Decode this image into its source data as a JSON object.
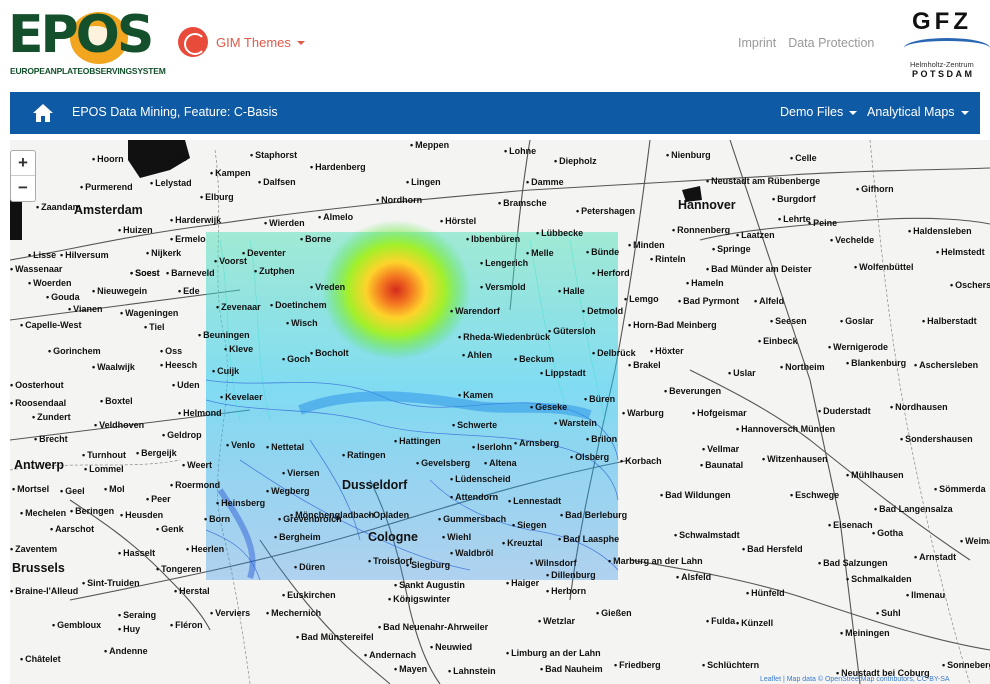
{
  "header": {
    "logo_text": "EPOS",
    "logo_subtitle": "EUROPEANPLATEOBSERVINGSYSTEM",
    "gim_menu_label": "GIM Themes",
    "links": [
      "Imprint",
      "Data Protection"
    ],
    "gfz_text": "GFZ",
    "gfz_subtitle": "Helmholtz-Zentrum",
    "gfz_city": "POTSDAM"
  },
  "navbar": {
    "home_icon": "home-icon",
    "title": "EPOS Data Mining, Feature: C-Basis",
    "menus": [
      "Demo Files",
      "Analytical Maps"
    ]
  },
  "map": {
    "zoom_in": "+",
    "zoom_out": "−",
    "heatmap_colors": [
      "#d11a0a",
      "#f46d10",
      "#ffd11a",
      "#9cf01a",
      "#35e23a",
      "#2adcc8",
      "#23c7f2",
      "#1e8de8",
      "#2156d6"
    ],
    "cities": [
      {
        "name": "Amsterdam",
        "big": true
      },
      {
        "name": "Hannover",
        "big": true
      },
      {
        "name": "Antwerp",
        "big": true
      },
      {
        "name": "Dusseldorf",
        "big": true
      },
      {
        "name": "Cologne",
        "big": true
      },
      {
        "name": "Brussels",
        "big": true
      },
      {
        "name": "Hoorn"
      },
      {
        "name": "Urk"
      },
      {
        "name": "Purmerend"
      },
      {
        "name": "Lelystad"
      },
      {
        "name": "Staphorst"
      },
      {
        "name": "Kampen"
      },
      {
        "name": "Dalfsen"
      },
      {
        "name": "Hardenberg"
      },
      {
        "name": "Meppen"
      },
      {
        "name": "Lohne"
      },
      {
        "name": "Diepholz"
      },
      {
        "name": "Nienburg"
      },
      {
        "name": "Celle"
      },
      {
        "name": "Lingen"
      },
      {
        "name": "Damme"
      },
      {
        "name": "Neustadt am Rübenberge"
      },
      {
        "name": "Gifhorn"
      },
      {
        "name": "Nordhorn"
      },
      {
        "name": "Bramsche"
      },
      {
        "name": "Burgdorf"
      },
      {
        "name": "Zaandam"
      },
      {
        "name": "Harderwijk"
      },
      {
        "name": "Elburg"
      },
      {
        "name": "Almelo"
      },
      {
        "name": "Wierden"
      },
      {
        "name": "Hörstel"
      },
      {
        "name": "Petershagen"
      },
      {
        "name": "Lehrte"
      },
      {
        "name": "Peine"
      },
      {
        "name": "Huizen"
      },
      {
        "name": "Ermelo"
      },
      {
        "name": "Lübbecke"
      },
      {
        "name": "Ronnenberg"
      },
      {
        "name": "Laatzen"
      },
      {
        "name": "Vechelde"
      },
      {
        "name": "Haldensleben"
      },
      {
        "name": "Hilversum"
      },
      {
        "name": "Nijkerk"
      },
      {
        "name": "Minden"
      },
      {
        "name": "Springe"
      },
      {
        "name": "Lisse"
      },
      {
        "name": "Rinteln"
      },
      {
        "name": "Helmstedt"
      },
      {
        "name": "Bünde"
      },
      {
        "name": "Wassenaar"
      },
      {
        "name": "Soest"
      },
      {
        "name": "Barneveld"
      },
      {
        "name": "Herford"
      },
      {
        "name": "Bad Münder am Deister"
      },
      {
        "name": "Wolfenbüttel"
      },
      {
        "name": "Woerden"
      },
      {
        "name": "Hameln"
      },
      {
        "name": "Gouda"
      },
      {
        "name": "Nieuwegein"
      },
      {
        "name": "Ede"
      },
      {
        "name": "Lemgo"
      },
      {
        "name": "Bad Pyrmont"
      },
      {
        "name": "Alfeld"
      },
      {
        "name": "Oschersleben"
      },
      {
        "name": "Vianen"
      },
      {
        "name": "Wageningen"
      },
      {
        "name": "Detmold"
      },
      {
        "name": "Seesen"
      },
      {
        "name": "Goslar"
      },
      {
        "name": "Halberstadt"
      },
      {
        "name": "Capelle-West"
      },
      {
        "name": "Tiel"
      },
      {
        "name": "Horn-Bad Meinberg"
      },
      {
        "name": "Gorinchem"
      },
      {
        "name": "Einbeck"
      },
      {
        "name": "Wernigerode"
      },
      {
        "name": "Waalwijk"
      },
      {
        "name": "Oss"
      },
      {
        "name": "Höxter"
      },
      {
        "name": "Blankenburg"
      },
      {
        "name": "Aschersleben"
      },
      {
        "name": "Heesch"
      },
      {
        "name": "Brakel"
      },
      {
        "name": "Uslar"
      },
      {
        "name": "Northeim"
      },
      {
        "name": "Oosterhout"
      },
      {
        "name": "Uden"
      },
      {
        "name": "Beverungen"
      },
      {
        "name": "Boxtel"
      },
      {
        "name": "Roosendaal"
      },
      {
        "name": "Zundert"
      },
      {
        "name": "Helmond"
      },
      {
        "name": "Warburg"
      },
      {
        "name": "Hofgeismar"
      },
      {
        "name": "Duderstadt"
      },
      {
        "name": "Nordhausen"
      },
      {
        "name": "Veldhoven"
      },
      {
        "name": "Hannoversch Münden"
      },
      {
        "name": "Brecht"
      },
      {
        "name": "Geldrop"
      },
      {
        "name": "Sondershausen"
      },
      {
        "name": "Turnhout"
      },
      {
        "name": "Bergeijk"
      },
      {
        "name": "Vellmar"
      },
      {
        "name": "Witzenhausen"
      },
      {
        "name": "Korbach"
      },
      {
        "name": "Lommel"
      },
      {
        "name": "Weert"
      },
      {
        "name": "Baunatal"
      },
      {
        "name": "Mühlhausen"
      },
      {
        "name": "Roermond"
      },
      {
        "name": "Mortsel"
      },
      {
        "name": "Geel"
      },
      {
        "name": "Mol"
      },
      {
        "name": "Bad Wildungen"
      },
      {
        "name": "Eschwege"
      },
      {
        "name": "Sömmerda"
      },
      {
        "name": "Peer"
      },
      {
        "name": "Mechelen"
      },
      {
        "name": "Beringen"
      },
      {
        "name": "Heusden"
      },
      {
        "name": "Aarschot"
      },
      {
        "name": "Genk"
      },
      {
        "name": "Bad Berleburg"
      },
      {
        "name": "Schwalmstadt"
      },
      {
        "name": "Bad Langensalza"
      },
      {
        "name": "Eisenach"
      },
      {
        "name": "Gotha"
      },
      {
        "name": "Weimar"
      },
      {
        "name": "Hasselt"
      },
      {
        "name": "Bad Laasphe"
      },
      {
        "name": "Bad Hersfeld"
      },
      {
        "name": "Arnstadt"
      },
      {
        "name": "Zaventem"
      },
      {
        "name": "Tongeren"
      },
      {
        "name": "Marburg an der Lahn"
      },
      {
        "name": "Bad Salzungen"
      },
      {
        "name": "Sint-Truiden"
      },
      {
        "name": "Alsfeld"
      },
      {
        "name": "Schmalkalden"
      },
      {
        "name": "Braine-l'Alleud"
      },
      {
        "name": "Herstal"
      },
      {
        "name": "Euskirchen"
      },
      {
        "name": "Königswinter"
      },
      {
        "name": "Herborn"
      },
      {
        "name": "Hünfeld"
      },
      {
        "name": "Ilmenau"
      },
      {
        "name": "Seraing"
      },
      {
        "name": "Verviers"
      },
      {
        "name": "Mechernich"
      },
      {
        "name": "Gießen"
      },
      {
        "name": "Suhl"
      },
      {
        "name": "Gembloux"
      },
      {
        "name": "Huy"
      },
      {
        "name": "Fléron"
      },
      {
        "name": "Bad Neuenahr-Ahrweiler"
      },
      {
        "name": "Wetzlar"
      },
      {
        "name": "Fulda"
      },
      {
        "name": "Künzell"
      },
      {
        "name": "Meiningen"
      },
      {
        "name": "Bad Münstereifel"
      },
      {
        "name": "Neuwied"
      },
      {
        "name": "Andernach"
      },
      {
        "name": "Limburg an der Lahn"
      },
      {
        "name": "Andenne"
      },
      {
        "name": "Châtelet"
      },
      {
        "name": "Mayen"
      },
      {
        "name": "Lahnstein"
      },
      {
        "name": "Bad Nauheim"
      },
      {
        "name": "Friedberg"
      },
      {
        "name": "Schlüchtern"
      },
      {
        "name": "Neustadt bei Coburg"
      },
      {
        "name": "Sonneberg"
      },
      {
        "name": "Sankt Augustin"
      },
      {
        "name": "Siegburg"
      },
      {
        "name": "Troisdorf"
      },
      {
        "name": "Haiger"
      },
      {
        "name": "Dillenburg"
      },
      {
        "name": "Kreuztal"
      },
      {
        "name": "Wilnsdorf"
      },
      {
        "name": "Gummersbach"
      },
      {
        "name": "Wiehl"
      },
      {
        "name": "Waldbröl"
      },
      {
        "name": "Opladen"
      },
      {
        "name": "Attendorn"
      },
      {
        "name": "Lennestadt"
      },
      {
        "name": "Lüdenscheid"
      },
      {
        "name": "Gevelsberg"
      },
      {
        "name": "Ratingen"
      },
      {
        "name": "Arnsberg"
      },
      {
        "name": "Olsberg"
      },
      {
        "name": "Brilon"
      },
      {
        "name": "Schwerte"
      },
      {
        "name": "Iserlohn"
      },
      {
        "name": "Hattingen"
      },
      {
        "name": "Viersen"
      },
      {
        "name": "Wegberg"
      },
      {
        "name": "Mönchengladbach"
      },
      {
        "name": "Grevenbroich"
      },
      {
        "name": "Bergheim"
      },
      {
        "name": "Düren"
      },
      {
        "name": "Heerlen"
      },
      {
        "name": "Heinsberg"
      },
      {
        "name": "Born"
      },
      {
        "name": "Venlo"
      },
      {
        "name": "Kevelaer"
      },
      {
        "name": "Nettetal"
      },
      {
        "name": "Kleve"
      },
      {
        "name": "Beuningen"
      },
      {
        "name": "Zevenaar"
      },
      {
        "name": "Doetinchem"
      },
      {
        "name": "Wisch"
      },
      {
        "name": "Bocholt"
      },
      {
        "name": "Cuijk"
      },
      {
        "name": "Goch"
      },
      {
        "name": "Voorst"
      },
      {
        "name": "Zutphen"
      },
      {
        "name": "Deventer"
      },
      {
        "name": "Borne"
      },
      {
        "name": "Vreden"
      },
      {
        "name": "Ahlen"
      },
      {
        "name": "Beckum"
      },
      {
        "name": "Lippstadt"
      },
      {
        "name": "Geseke"
      },
      {
        "name": "Büren"
      },
      {
        "name": "Warstein"
      },
      {
        "name": "Kamen"
      },
      {
        "name": "Soest"
      },
      {
        "name": "Rheda-Wiedenbrück"
      },
      {
        "name": "Gütersloh"
      },
      {
        "name": "Delbrück"
      },
      {
        "name": "Warendorf"
      },
      {
        "name": "Versmold"
      },
      {
        "name": "Halle"
      },
      {
        "name": "Melle"
      },
      {
        "name": "Lengerich"
      },
      {
        "name": "Ibbenbüren"
      },
      {
        "name": "Altena"
      },
      {
        "name": "Siegen"
      }
    ],
    "attribution": "Leaflet | Map data © OpenStreetMap contributors, CC-BY-SA"
  }
}
